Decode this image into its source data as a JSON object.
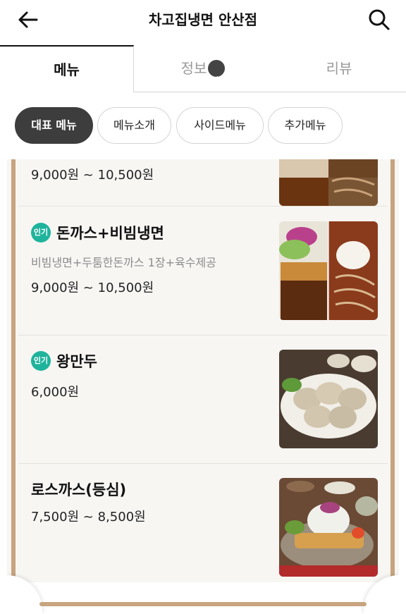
{
  "header": {
    "title": "차고집냉면 안산점"
  },
  "tabs": [
    {
      "label": "메뉴"
    },
    {
      "label": "정보"
    },
    {
      "label": "리뷰"
    }
  ],
  "chips": [
    {
      "label": "대표 메뉴"
    },
    {
      "label": "메뉴소개"
    },
    {
      "label": "사이드메뉴"
    },
    {
      "label": "추가메뉴"
    }
  ],
  "menu": {
    "partial_item": {
      "price": "9,000원 ~ 10,500원"
    },
    "items": [
      {
        "badge": "인기",
        "name": "돈까스+비빔냉면",
        "description": "비빔냉면+두툼한돈까스 1장+육수제공",
        "price": "9,000원 ~ 10,500원"
      },
      {
        "badge": "인기",
        "name": "왕만두",
        "price": "6,000원"
      },
      {
        "name": "로스까스(등심)",
        "price": "7,500원 ~ 8,500원"
      }
    ]
  },
  "colors": {
    "accent_brown": "#c7a47f",
    "popular_badge": "#1fb39c",
    "chip_active": "#3d3d3d"
  }
}
